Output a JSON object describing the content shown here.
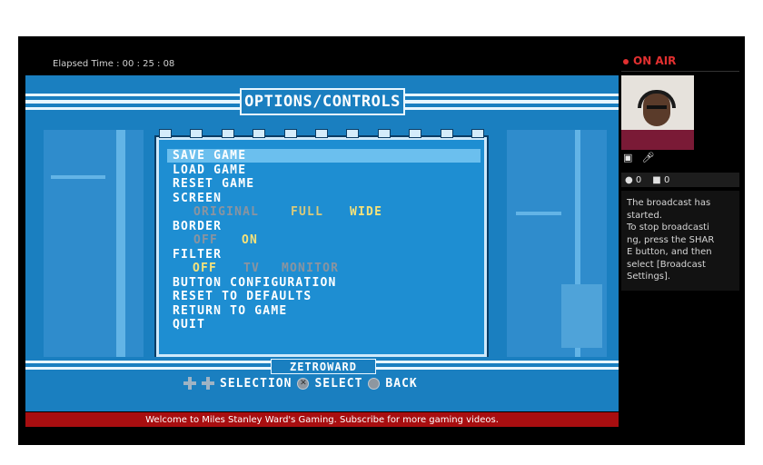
{
  "stream": {
    "elapsed_label": "Elapsed Time : 00 : 25 : 08",
    "ticker": "Welcome to Miles Stanley Ward's Gaming. Subscribe for more gaming videos."
  },
  "game": {
    "title": "OPTIONS/CONTROLS",
    "menu": {
      "save_game": "SAVE GAME",
      "load_game": "LOAD GAME",
      "reset_game": "RESET GAME",
      "screen": "SCREEN",
      "screen_options": [
        "ORIGINAL",
        "FULL",
        "WIDE"
      ],
      "border": "BORDER",
      "border_options": [
        "OFF",
        "ON"
      ],
      "filter": "FILTER",
      "filter_options": [
        "OFF",
        "TV",
        "MONITOR"
      ],
      "button_configuration": "BUTTON CONFIGURATION",
      "reset_to_defaults": "RESET TO DEFAULTS",
      "return_to_game": "RETURN TO GAME",
      "quit": "QUIT"
    },
    "footer_label": "ZETROWARD",
    "controls": {
      "selection": "SELECTION",
      "select": "SELECT",
      "back": "BACK"
    }
  },
  "broadcast": {
    "on_air": "ON AIR",
    "viewers": "0",
    "comments": "0",
    "message": "The broadcast has\nstarted.\nTo stop broadcasti\nng, press the SHAR\nE button, and then\nselect [Broadcast\nSettings]."
  },
  "colors": {
    "game_blue": "#1a7fc0",
    "highlight": "#6bbfee",
    "active_option": "#f5e27a",
    "inactive_option": "#8a94a0",
    "ticker_red": "#a80e10",
    "on_air_red": "#e23030"
  }
}
